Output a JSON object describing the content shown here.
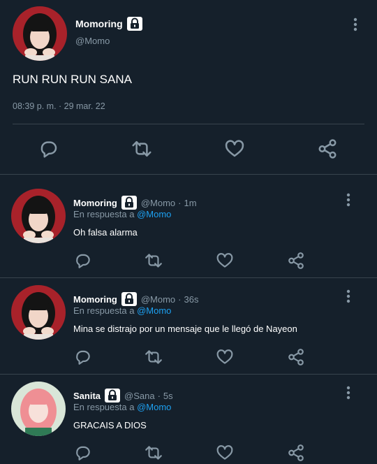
{
  "main_tweet": {
    "display_name": "Momoring",
    "handle": "@Momo",
    "text": "RUN RUN RUN SANA",
    "timestamp": "08:39 p. m. · 29 mar. 22",
    "avatar_icon": "profile-photo"
  },
  "replies": [
    {
      "display_name": "Momoring",
      "handle": "@Momo",
      "separator": "·",
      "time": "1m",
      "reply_prefix": "En respuesta a",
      "reply_to": "@Momo",
      "text": "Oh falsa alarma"
    },
    {
      "display_name": "Momoring",
      "handle": "@Momo",
      "separator": "·",
      "time": "36s",
      "reply_prefix": "En respuesta a",
      "reply_to": "@Momo",
      "text": "Mina se distrajo por un mensaje que le llegó de Nayeon"
    },
    {
      "display_name": "Sanita",
      "handle": "@Sana",
      "separator": "·",
      "time": "5s",
      "reply_prefix": "En respuesta a",
      "reply_to": "@Momo",
      "text": "GRACAIS A DIOS"
    }
  ],
  "colors": {
    "background": "#15202b",
    "secondary_text": "#8899a6",
    "link": "#1da1f2",
    "divider": "#38444d"
  },
  "icons": [
    "reply-icon",
    "retweet-icon",
    "like-icon",
    "share-icon",
    "lock-icon",
    "more-icon"
  ]
}
